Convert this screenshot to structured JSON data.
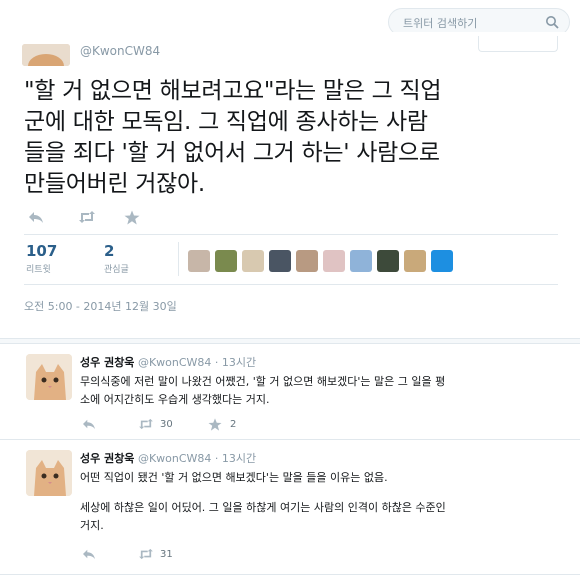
{
  "search": {
    "placeholder": "트위터 검색하기",
    "icon": "search-icon"
  },
  "main_tweet": {
    "handle": "@KwonCW84",
    "text_lines": [
      "\"할 거 없으면 해보려고요\"라는 말은 그 직업",
      "군에 대한 모독임. 그 직업에 종사하는 사람",
      "들을 죄다 '할 거 없어서 그거 하는' 사람으로",
      "만들어버린 거잖아."
    ],
    "actions": {
      "reply_icon": "reply-icon",
      "retweet_icon": "retweet-icon",
      "favorite_icon": "star-icon"
    },
    "stats": {
      "retweets": {
        "count": "107",
        "label": "리트윗"
      },
      "favorites": {
        "count": "2",
        "label": "관심글"
      }
    },
    "timestamp": "오전 5:00 - 2014년 12월 30일"
  },
  "replies": [
    {
      "name": "성우 권창욱",
      "handle": "@KwonCW84",
      "time": "· 13시간",
      "lines": [
        "무의식중에 저런 말이 나왔건 어쨌건, '할 거 없으면 해보겠다'는 말은 그 일을 평",
        "소에 어지간히도 우습게 생각했다는 거지."
      ],
      "retweets": "30",
      "favorites": "2"
    },
    {
      "name": "성우 권창욱",
      "handle": "@KwonCW84",
      "time": "· 13시간",
      "lines": [
        "어떤 직업이 됐건 '할 거 없으면 해보겠다'는 말을 들을 이유는 없음.",
        "",
        "세상에 하찮은 일이 어딨어. 그 일을 하찮게 여기는 사람의 인격이 하찮은 수준인",
        "거지."
      ],
      "retweets": "31"
    }
  ],
  "colors": {
    "stat_number": "#2b5f8a",
    "muted": "#8899a6",
    "border": "#e1e8ed"
  }
}
